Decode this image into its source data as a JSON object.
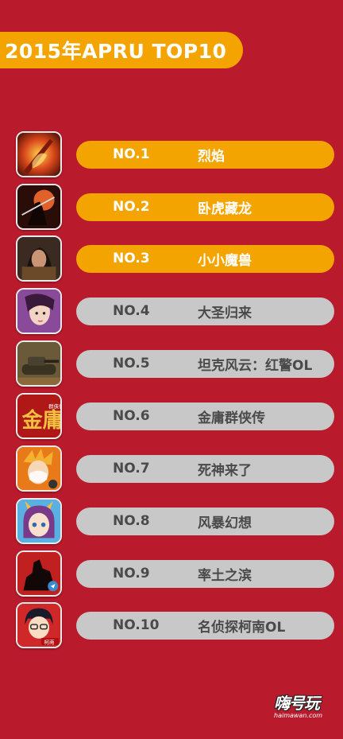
{
  "title": "2015年APRU TOP10",
  "items": [
    {
      "rank": "NO.1",
      "name": "烈焰",
      "style": "gold",
      "icon": "flame-warrior-icon"
    },
    {
      "rank": "NO.2",
      "name": "卧虎藏龙",
      "style": "gold",
      "icon": "swordsman-moon-icon"
    },
    {
      "rank": "NO.3",
      "name": "小小魔兽",
      "style": "gold",
      "icon": "warrior-portrait-icon"
    },
    {
      "rank": "NO.4",
      "name": "大圣归来",
      "style": "gray",
      "icon": "heroine-portrait-icon"
    },
    {
      "rank": "NO.5",
      "name": "坦克风云：红警OL",
      "style": "gray",
      "icon": "tank-icon"
    },
    {
      "rank": "NO.6",
      "name": "金庸群侠传",
      "style": "gray",
      "icon": "jin-yong-calligraphy-icon"
    },
    {
      "rank": "NO.7",
      "name": "死神来了",
      "style": "gray",
      "icon": "anime-character-icon"
    },
    {
      "rank": "NO.8",
      "name": "风暴幻想",
      "style": "gray",
      "icon": "horned-girl-icon"
    },
    {
      "rank": "NO.9",
      "name": "率土之滨",
      "style": "gray",
      "icon": "horse-rider-icon"
    },
    {
      "rank": "NO.10",
      "name": "名侦探柯南OL",
      "style": "gray",
      "icon": "detective-icon"
    }
  ],
  "icon_text": {
    "jinyong_big": "金庸",
    "jinyong_small": "群侠传",
    "conan_tag": "柯南"
  },
  "logo": {
    "main": "嗨号玩",
    "sub": "haimawan.com"
  },
  "colors": {
    "background": "#b91a2c",
    "gold": "#f4a400",
    "gray": "#c8c8c8"
  }
}
